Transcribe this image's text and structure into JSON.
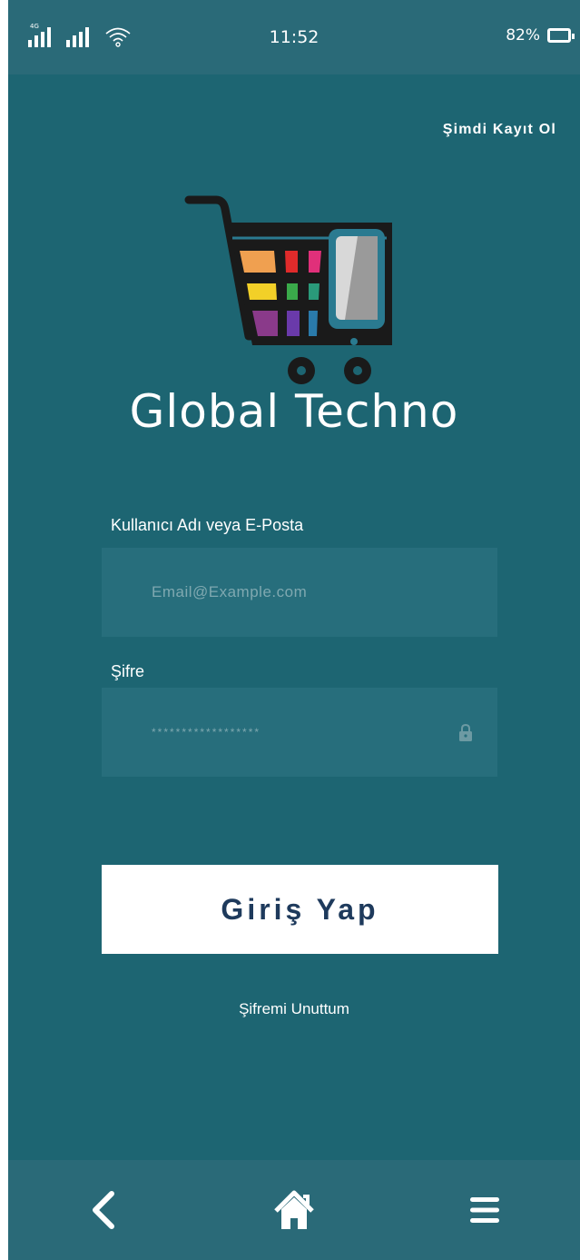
{
  "status_bar": {
    "network_label": "4G",
    "time": "11:52",
    "battery_percent": "82%",
    "battery_level": 0.82
  },
  "header": {
    "register_link": "Şimdi Kayıt Ol"
  },
  "brand": {
    "name": "Global Techno"
  },
  "login_form": {
    "username_label": "Kullanıcı Adı veya E-Posta",
    "username_value": "",
    "username_placeholder": "Email@Example.com",
    "password_label": "Şifre",
    "password_value": "",
    "password_placeholder": "******************",
    "submit_label": "Giriş Yap",
    "forgot_link": "Şifremi Unuttum"
  },
  "bottom_nav": {
    "items": [
      {
        "icon": "chevron-left-icon"
      },
      {
        "icon": "home-icon"
      },
      {
        "icon": "menu-icon"
      }
    ]
  },
  "colors": {
    "background": "#1d6572",
    "bars": "#2a6a78",
    "input_bg": "#276e7c",
    "button_text": "#1e3a5c"
  }
}
